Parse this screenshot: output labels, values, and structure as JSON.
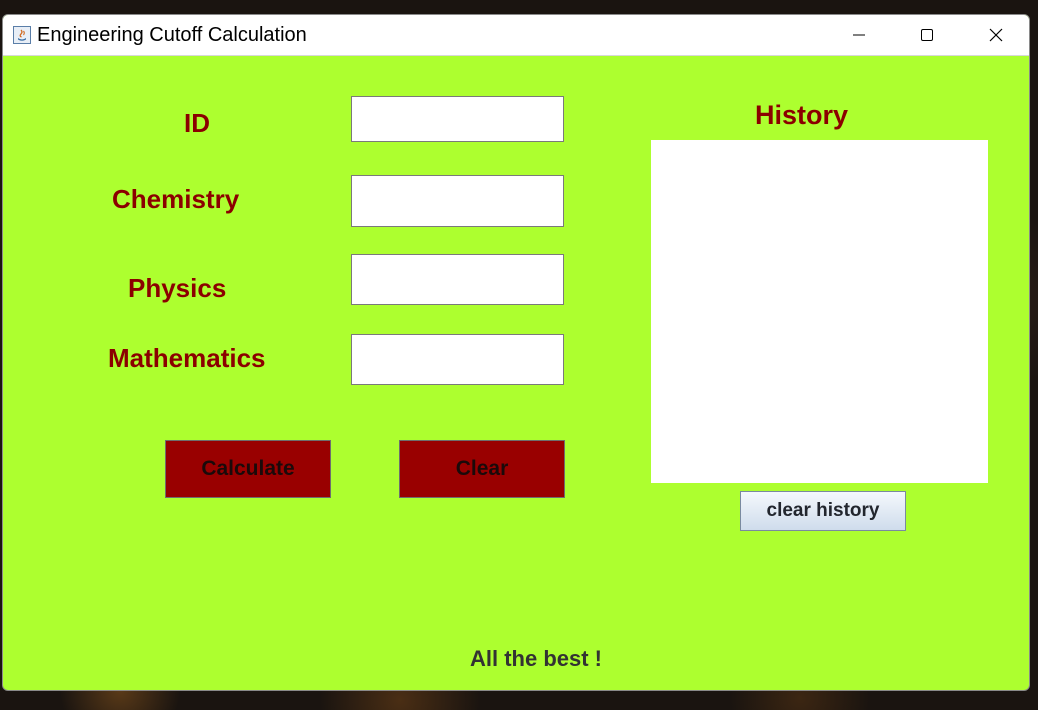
{
  "window": {
    "title": "Engineering Cutoff Calculation",
    "controls": [
      "minimize-icon",
      "maximize-icon",
      "close-icon"
    ]
  },
  "form": {
    "id_label": "ID",
    "chemistry_label": "Chemistry",
    "physics_label": "Physics",
    "mathematics_label": "Mathematics",
    "id_value": "",
    "chemistry_value": "",
    "physics_value": "",
    "mathematics_value": ""
  },
  "buttons": {
    "calculate_label": "Calculate",
    "clear_label": "Clear",
    "clear_history_label": "clear history"
  },
  "history": {
    "title": "History",
    "content": ""
  },
  "footer": {
    "message": "All the best !"
  },
  "colors": {
    "window_background": "#adff2f",
    "label_text": "#8b0000",
    "button_background": "#990000"
  }
}
